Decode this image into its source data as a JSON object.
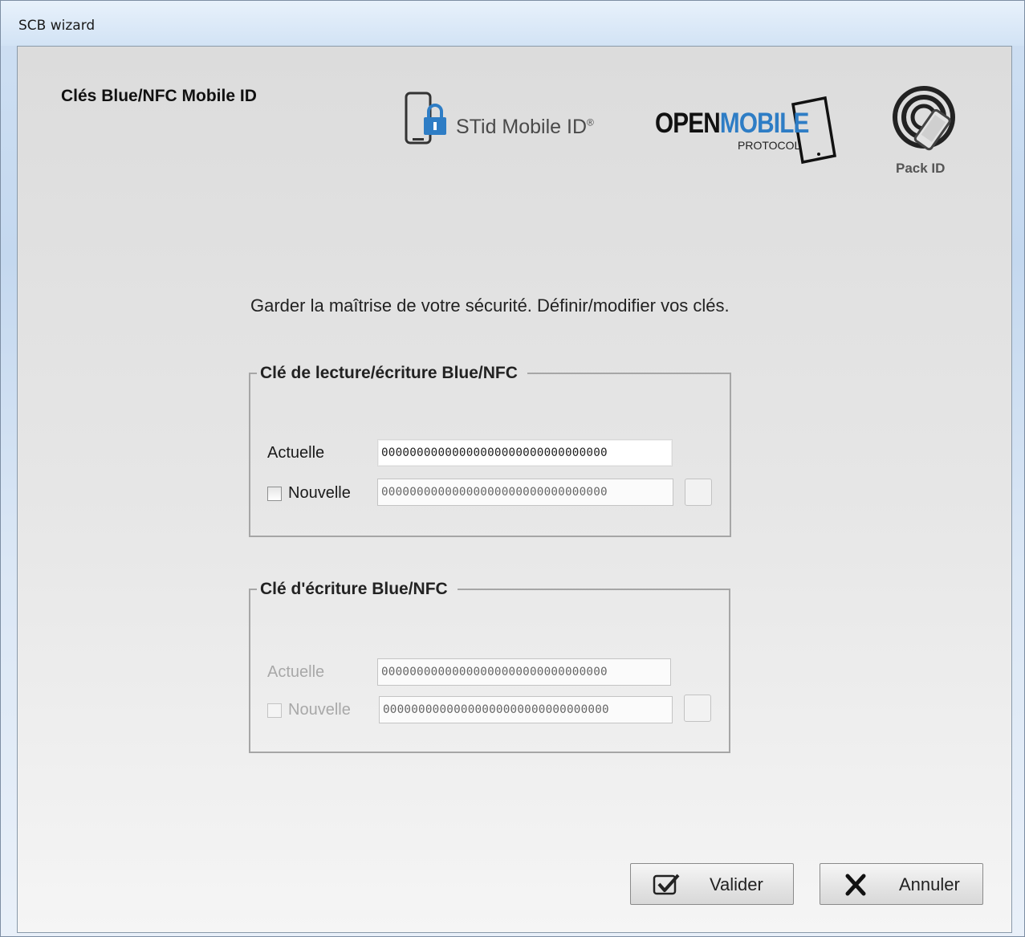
{
  "window": {
    "title": "SCB wizard"
  },
  "header": {
    "title": "Clés Blue/NFC Mobile ID",
    "logos": {
      "stid": {
        "text": "STid Mobile ID",
        "mark": "®"
      },
      "openmobile": {
        "open": "OPEN",
        "mobile": "MOBILE",
        "protocol": "PROTOCOL"
      },
      "packid": {
        "text": "Pack ID"
      }
    }
  },
  "intro": "Garder la maîtrise de votre sécurité. Définir/modifier vos clés.",
  "groups": [
    {
      "title": "Clé de lecture/écriture Blue/NFC",
      "current_label": "Actuelle",
      "current_value": "00000000000000000000000000000000",
      "new_label": "Nouvelle",
      "new_value": "00000000000000000000000000000000",
      "new_checked": false,
      "enabled": true
    },
    {
      "title": "Clé d'écriture Blue/NFC",
      "current_label": "Actuelle",
      "current_value": "00000000000000000000000000000000",
      "new_label": "Nouvelle",
      "new_value": "00000000000000000000000000000000",
      "new_checked": false,
      "enabled": false
    }
  ],
  "buttons": {
    "validate": "Valider",
    "cancel": "Annuler"
  },
  "icons": {
    "validate": "checkbox-check-icon",
    "cancel": "x-icon"
  },
  "colors": {
    "openmobile_blue": "#2e7dc5",
    "disabled_text": "#a8a8a8"
  }
}
